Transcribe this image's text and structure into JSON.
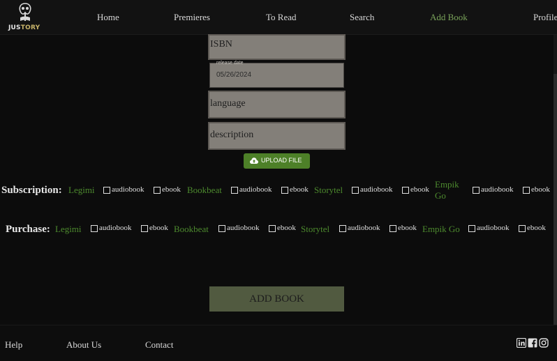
{
  "header": {
    "logo": {
      "text_a": "JUS",
      "text_b": "TORY"
    },
    "nav": [
      {
        "label": "Home"
      },
      {
        "label": "Premieres"
      },
      {
        "label": "To Read"
      },
      {
        "label": "Search"
      },
      {
        "label": "Add Book",
        "active": true
      },
      {
        "label": "Profile"
      }
    ]
  },
  "form": {
    "isbn_placeholder": "ISBN",
    "release_date_label": "release date",
    "release_date_value": "05/26/2024",
    "language_placeholder": "language",
    "description_placeholder": "description",
    "upload_label": "UPLOAD FILE",
    "submit_label": "ADD BOOK"
  },
  "subscription": {
    "title": "Subscription:",
    "providers": [
      {
        "name": "Legimi",
        "options": [
          "audiobook",
          "ebook"
        ]
      },
      {
        "name": "Bookbeat",
        "options": [
          "audiobook",
          "ebook"
        ]
      },
      {
        "name": "Storytel",
        "options": [
          "audiobook",
          "ebook"
        ]
      },
      {
        "name_line1": "Empik",
        "name_line2": "Go",
        "options": [
          "audiobook",
          "ebook"
        ]
      }
    ]
  },
  "purchase": {
    "title": "Purchase:",
    "providers": [
      {
        "name": "Legimi",
        "options": [
          "audiobook",
          "ebook"
        ]
      },
      {
        "name": "Bookbeat",
        "options": [
          "audiobook",
          "ebook"
        ]
      },
      {
        "name": "Storytel",
        "options": [
          "audiobook",
          "ebook"
        ]
      },
      {
        "name": "Empik Go",
        "options": [
          "audiobook",
          "ebook"
        ]
      }
    ]
  },
  "footer": {
    "links": [
      "Help",
      "About Us",
      "Contact"
    ],
    "social": [
      "linkedin-icon",
      "facebook-icon",
      "instagram-icon"
    ]
  },
  "colors": {
    "accent_green": "#4d8a2e",
    "active_nav": "#7aa35a",
    "field_bg": "#837f79",
    "button_green": "#4d8028",
    "submit_bg": "#515a40"
  }
}
